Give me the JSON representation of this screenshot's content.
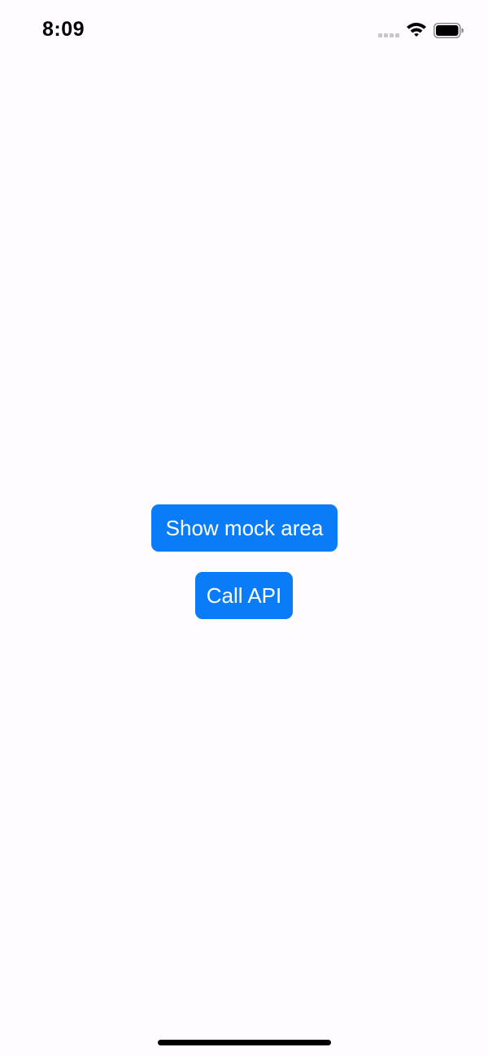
{
  "status_bar": {
    "time": "8:09",
    "icons": [
      "signal-dots-icon",
      "wifi-icon",
      "battery-icon"
    ]
  },
  "main": {
    "show_mock_area_label": "Show mock area",
    "call_api_label": "Call API"
  },
  "colors": {
    "background": "#fefcff",
    "button": "#0a7cf7",
    "button_text": "#ffffff"
  }
}
